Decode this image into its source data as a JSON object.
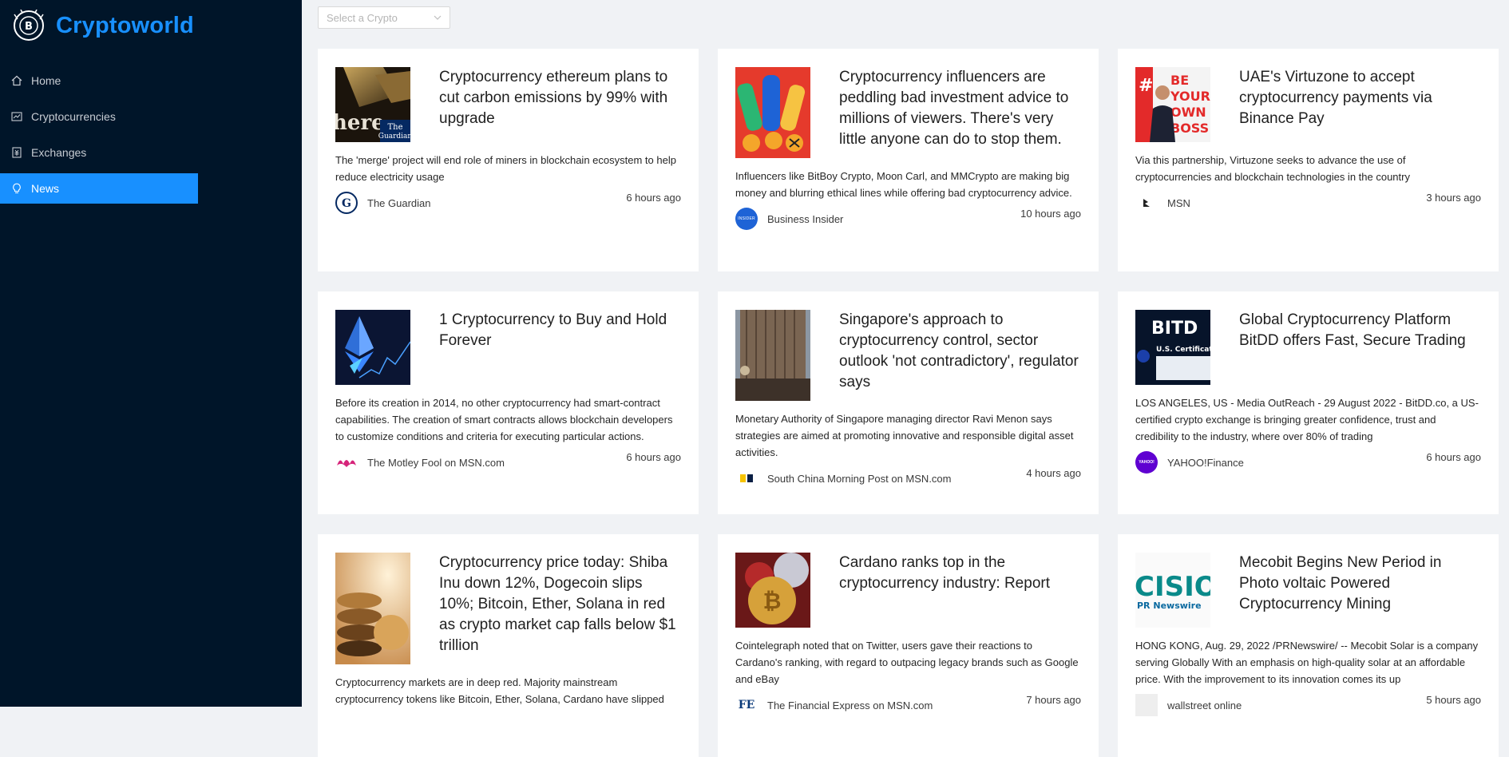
{
  "brand": {
    "name": "Cryptoworld",
    "accent": "#1890ff"
  },
  "menu": [
    {
      "label": "Home",
      "icon": "home-icon",
      "active": false
    },
    {
      "label": "Cryptocurrencies",
      "icon": "fund-icon",
      "active": false
    },
    {
      "label": "Exchanges",
      "icon": "money-collect-icon",
      "active": false
    },
    {
      "label": "News",
      "icon": "bulb-icon",
      "active": true
    }
  ],
  "select": {
    "placeholder": "Select a Crypto"
  },
  "news": [
    {
      "title": "Cryptocurrency ethereum plans to cut carbon emissions by 99% with upgrade",
      "description": "The 'merge' project will end role of miners in blockchain ecosystem to help reduce electricity usage",
      "provider": "The Guardian",
      "time": "6 hours ago"
    },
    {
      "title": "Cryptocurrency influencers are peddling bad investment advice to millions of viewers. There's very little anyone can do to stop them.",
      "description": "Influencers like BitBoy Crypto, Moon Carl, and MMCrypto are making big money and blurring ethical lines while offering bad cryptocurrency advice.",
      "provider": "Business Insider",
      "time": "10 hours ago"
    },
    {
      "title": "UAE's Virtuzone to accept cryptocurrency payments via Binance Pay",
      "description": "Via this partnership, Virtuzone seeks to advance the use of cryptocurrencies and blockchain technologies in the country",
      "provider": "MSN",
      "time": "3 hours ago"
    },
    {
      "title": "1 Cryptocurrency to Buy and Hold Forever",
      "description": "Before its creation in 2014, no other cryptocurrency had smart-contract capabilities. The creation of smart contracts allows blockchain developers to customize conditions and criteria for executing particular actions.",
      "provider": "The Motley Fool on MSN.com",
      "time": "6 hours ago"
    },
    {
      "title": "Singapore's approach to cryptocurrency control, sector outlook 'not contradictory', regulator says",
      "description": "Monetary Authority of Singapore managing director Ravi Menon says strategies are aimed at promoting innovative and responsible digital asset activities.",
      "provider": "South China Morning Post on MSN.com",
      "time": "4 hours ago"
    },
    {
      "title": "Global Cryptocurrency Platform BitDD offers Fast, Secure Trading",
      "description": "LOS ANGELES, US - Media OutReach - 29 August 2022 - BitDD.co, a US-certified crypto exchange is bringing greater confidence, trust and credibility to the industry, where over 80% of trading",
      "provider": "YAHOO!Finance",
      "time": "6 hours ago"
    },
    {
      "title": "Cryptocurrency price today: Shiba Inu down 12%, Dogecoin slips 10%; Bitcoin, Ether, Solana in red as crypto market cap falls below $1 trillion",
      "description": "Cryptocurrency markets are in deep red. Majority mainstream cryptocurrency tokens like Bitcoin, Ether, Solana, Cardano have slipped",
      "provider": "",
      "time": ""
    },
    {
      "title": "Cardano ranks top in the cryptocurrency industry: Report",
      "description": "Cointelegraph noted that on Twitter, users gave their reactions to Cardano's ranking, with regard to outpacing legacy brands such as Google and eBay",
      "provider": "The Financial Express on MSN.com",
      "time": "7 hours ago"
    },
    {
      "title": "Mecobit Begins New Period in Photo voltaic Powered Cryptocurrency Mining",
      "description": "HONG KONG, Aug. 29, 2022 /PRNewswire/ -- Mecobit Solar is a company serving Globally With an emphasis on high-quality solar at an affordable price. With the improvement to its innovation comes its up",
      "provider": "wallstreet online",
      "time": "5 hours ago"
    }
  ],
  "thumb_text": {
    "guardian": "here",
    "guardian_logo_1": "The",
    "guardian_logo_2": "Guardian",
    "uae_1": "BE",
    "uae_2": "YOUR",
    "uae_3": "OWN",
    "uae_4": "BOSS",
    "bitdd_1": "BITD",
    "bitdd_2": "U.S. Certificat",
    "cision_1": "CISIO",
    "cision_2": "PR Newswire",
    "bi_icon": "INSIDER",
    "yahoo_icon": "YAHOO!",
    "fe_icon": "FE"
  }
}
